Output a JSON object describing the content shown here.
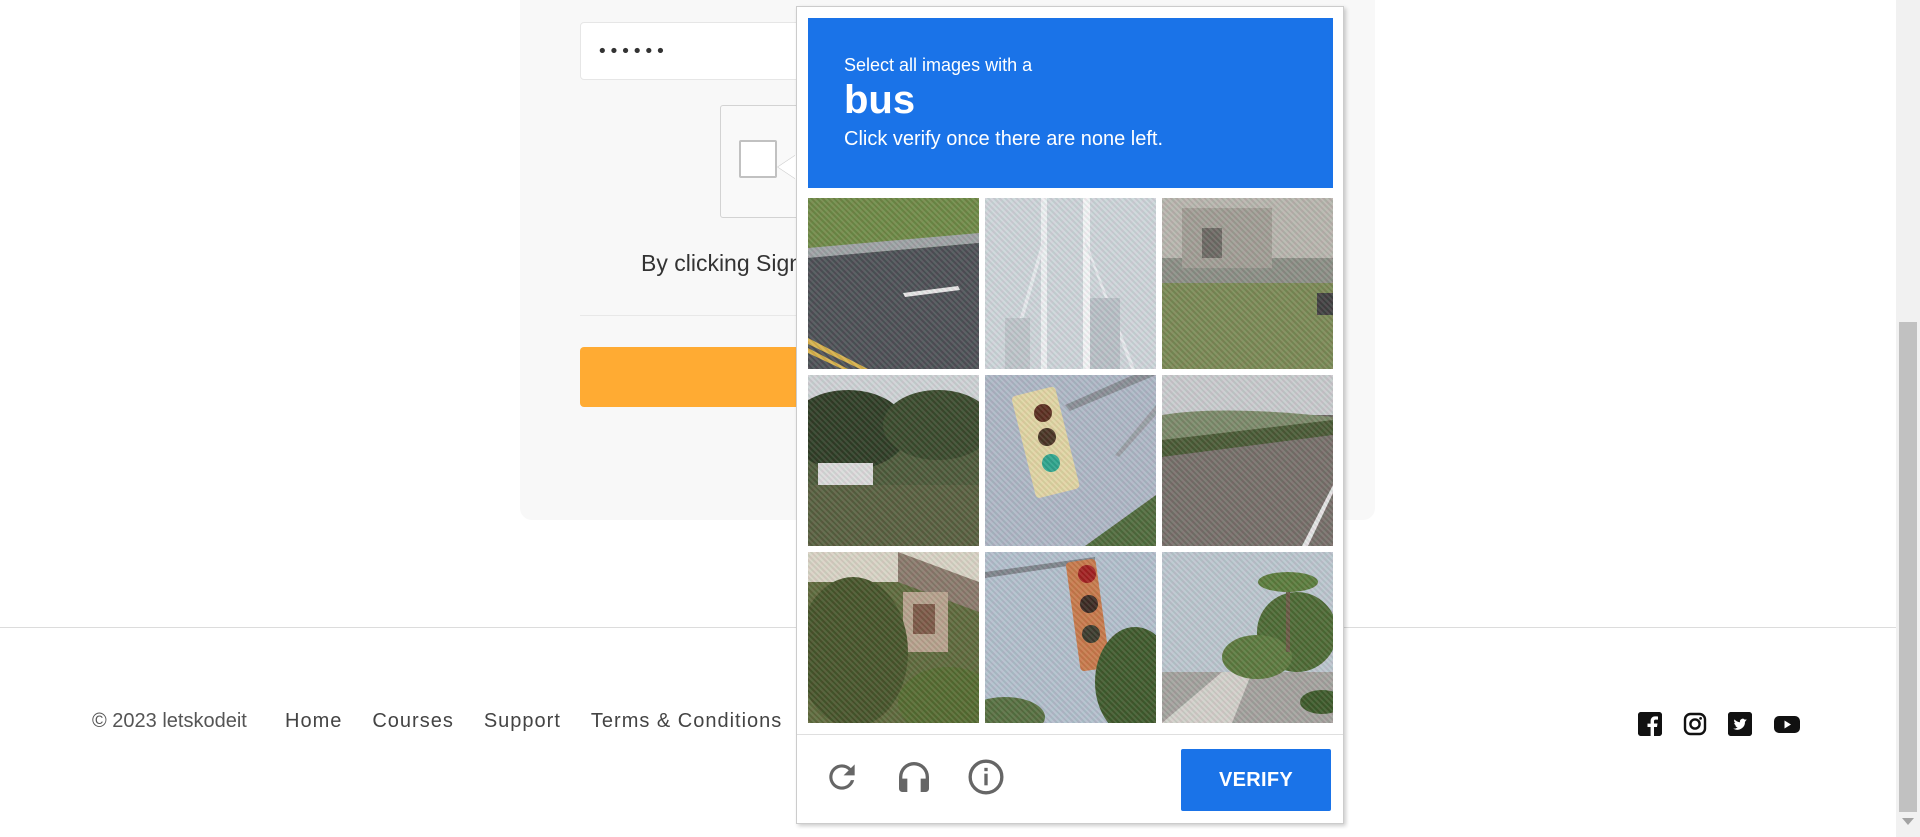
{
  "form": {
    "password_value": "••••••",
    "terms_text": "By clicking Sign"
  },
  "footer": {
    "copyright": "© 2023 letskodeit",
    "links": [
      "Home",
      "Courses",
      "Support",
      "Terms & Conditions"
    ],
    "social_icons": [
      "facebook-icon",
      "instagram-icon",
      "twitter-icon",
      "youtube-icon"
    ]
  },
  "captcha": {
    "instruction": "Select all images with a",
    "target": "bus",
    "sub_instruction": "Click verify once there are none left.",
    "tiles": [
      {
        "id": "1",
        "scene": "road-with-trees"
      },
      {
        "id": "2",
        "scene": "bridge-cables"
      },
      {
        "id": "3",
        "scene": "grass-building"
      },
      {
        "id": "4",
        "scene": "trees-car"
      },
      {
        "id": "5",
        "scene": "traffic-light"
      },
      {
        "id": "6",
        "scene": "highway-hills"
      },
      {
        "id": "7",
        "scene": "house-shrubs"
      },
      {
        "id": "8",
        "scene": "traffic-light-red"
      },
      {
        "id": "9",
        "scene": "street-palm-trees"
      }
    ],
    "controls": [
      "reload-icon",
      "headphones-icon",
      "info-icon"
    ],
    "verify_label": "VERIFY"
  },
  "colors": {
    "challenge_blue": "#1a73e8",
    "signup_orange": "#ffab33"
  }
}
